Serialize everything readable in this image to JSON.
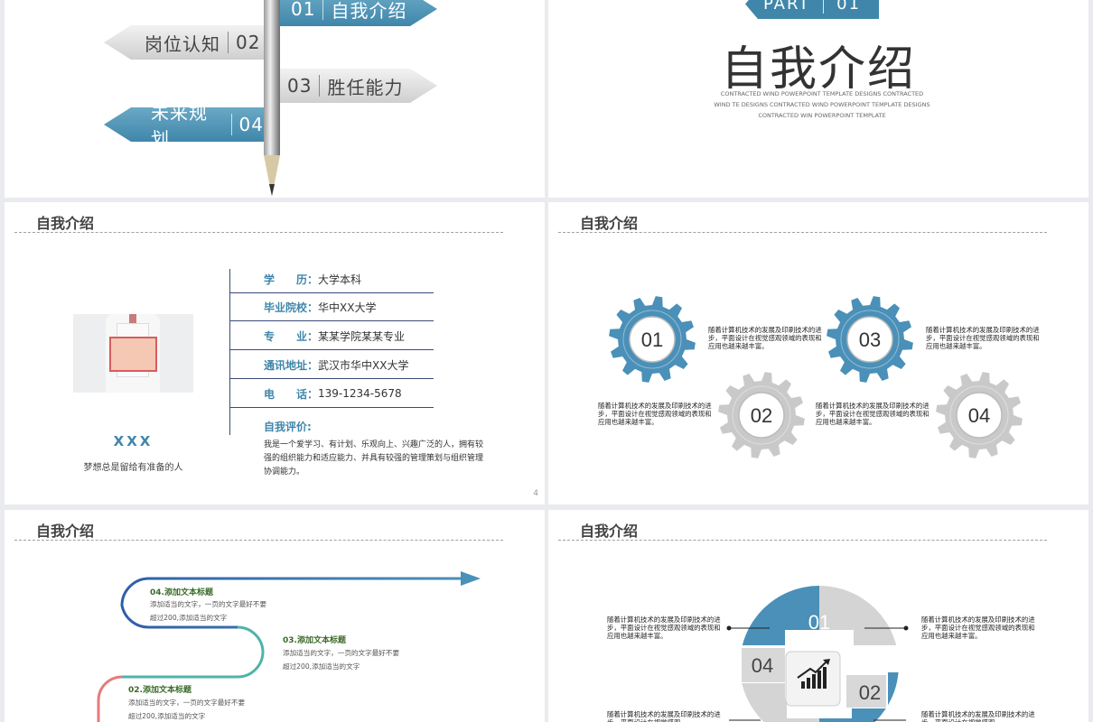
{
  "slide1": {
    "signs": [
      {
        "num": "01",
        "label": "自我介绍"
      },
      {
        "num": "02",
        "label": "岗位认知"
      },
      {
        "num": "03",
        "label": "胜任能力"
      },
      {
        "num": "04",
        "label": "未来规划"
      }
    ]
  },
  "slide2": {
    "part_label": "PART",
    "part_num": "01",
    "title": "自我介绍",
    "subtitle_en": "CONTRACTED WIND POWERPOINT TEMPLATE DESIGNS CONTRACTED WIND TE DESIGNS CONTRACTED WIND POWERPOINT TEMPLATE DESIGNS CONTRACTED WIN POWERPOINT TEMPLATE"
  },
  "slide3": {
    "title": "自我介绍",
    "name": "XXX",
    "motto": "梦想总是留给有准备的人",
    "info": [
      {
        "key": "学　　历：",
        "value": "大学本科"
      },
      {
        "key": "毕业院校：",
        "value": "华中XX大学"
      },
      {
        "key": "专　　业：",
        "value": "某某学院某某专业"
      },
      {
        "key": "通讯地址：",
        "value": "武汉市华中XX大学"
      },
      {
        "key": "电　　话：",
        "value": "139-1234-5678"
      }
    ],
    "eval_label": "自我评价:",
    "eval_text": "我是一个爱学习、有计划、乐观向上、兴趣广泛的人，拥有较强的组织能力和适应能力、并具有较强的管理策划与组织管理协调能力。",
    "page_num": "4"
  },
  "slide4": {
    "title": "自我介绍",
    "items": [
      {
        "num": "01",
        "text": "随着计算机技术的发展及印刷技术的进步，平面设计在视觉感观领域的表现和应用也越来越丰富。"
      },
      {
        "num": "02",
        "text": "随着计算机技术的发展及印刷技术的进步，平面设计在视觉感观领域的表现和应用也越来越丰富。"
      },
      {
        "num": "03",
        "text": "随着计算机技术的发展及印刷技术的进步，平面设计在视觉感观领域的表现和应用也越来越丰富。"
      },
      {
        "num": "04",
        "text": "随着计算机技术的发展及印刷技术的进步，平面设计在视觉感观领域的表现和应用也越来越丰富。"
      }
    ],
    "colors": {
      "blue": "#4a90b8",
      "grey": "#c9c9c9"
    }
  },
  "slide5": {
    "title": "自我介绍",
    "steps": [
      {
        "title": "04.添加文本标题",
        "line1": "添加适当的文字，一页的文字最好不要",
        "line2": "超过200,添加适当的文字"
      },
      {
        "title": "03.添加文本标题",
        "line1": "添加适当的文字，一页的文字最好不要",
        "line2": "超过200,添加适当的文字"
      },
      {
        "title": "02.添加文本标题",
        "line1": "添加适当的文字，一页的文字最好不要",
        "line2": "超过200,添加适当的文字"
      }
    ]
  },
  "slide6": {
    "title": "自我介绍",
    "segments": [
      "01",
      "02",
      "04"
    ],
    "texts": [
      "随着计算机技术的发展及印刷技术的进步，平面设计在视觉感观领域的表现和应用也越来越丰富。",
      "随着计算机技术的发展及印刷技术的进步，平面设计在视觉感观领域的表现和应用也越来越丰富。",
      "随着计算机技术的发展及印刷技术的进步，平面设计在视觉感观",
      "随着计算机技术的发展及印刷技术的进步，平面设计在视觉感观"
    ],
    "icon": "growth-chart-icon"
  }
}
